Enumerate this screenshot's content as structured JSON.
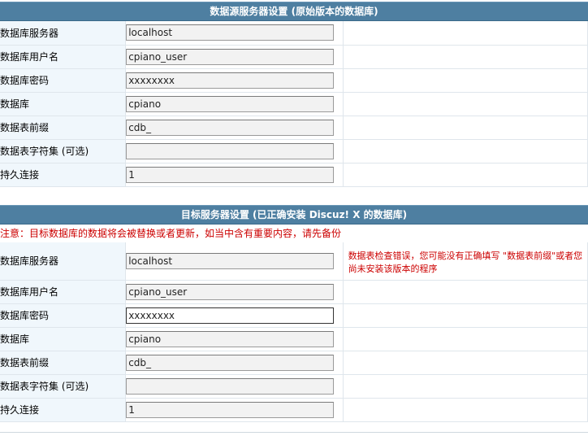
{
  "source": {
    "header": "数据源服务器设置 (原始版本的数据库)",
    "rows": [
      {
        "label": "数据库服务器",
        "value": "localhost"
      },
      {
        "label": "数据库用户名",
        "value": "cpiano_user"
      },
      {
        "label": "数据库密码",
        "value": "xxxxxxxx"
      },
      {
        "label": "数据库",
        "value": "cpiano"
      },
      {
        "label": "数据表前缀",
        "value": "cdb_"
      },
      {
        "label": "数据表字符集 (可选)",
        "value": ""
      },
      {
        "label": "持久连接",
        "value": "1"
      }
    ]
  },
  "target": {
    "header": "目标服务器设置 (已正确安装 Discuz! X 的数据库)",
    "notice": "注意：目标数据库的数据将会被替换或者更新，如当中含有重要内容，请先备份",
    "error": "数据表检查错误，您可能没有正确填写 \"数据表前缀\"或者您尚未安装该版本的程序",
    "rows": [
      {
        "label": "数据库服务器",
        "value": "localhost"
      },
      {
        "label": "数据库用户名",
        "value": "cpiano_user"
      },
      {
        "label": "数据库密码",
        "value": "xxxxxxxx"
      },
      {
        "label": "数据库",
        "value": "cpiano"
      },
      {
        "label": "数据表前缀",
        "value": "cdb_"
      },
      {
        "label": "数据表字符集 (可选)",
        "value": ""
      },
      {
        "label": "持久连接",
        "value": "1"
      }
    ]
  },
  "colors": {
    "header_bg": "#4e7fa1",
    "label_bg": "#f0f7fc",
    "error_text": "#cc0000"
  }
}
